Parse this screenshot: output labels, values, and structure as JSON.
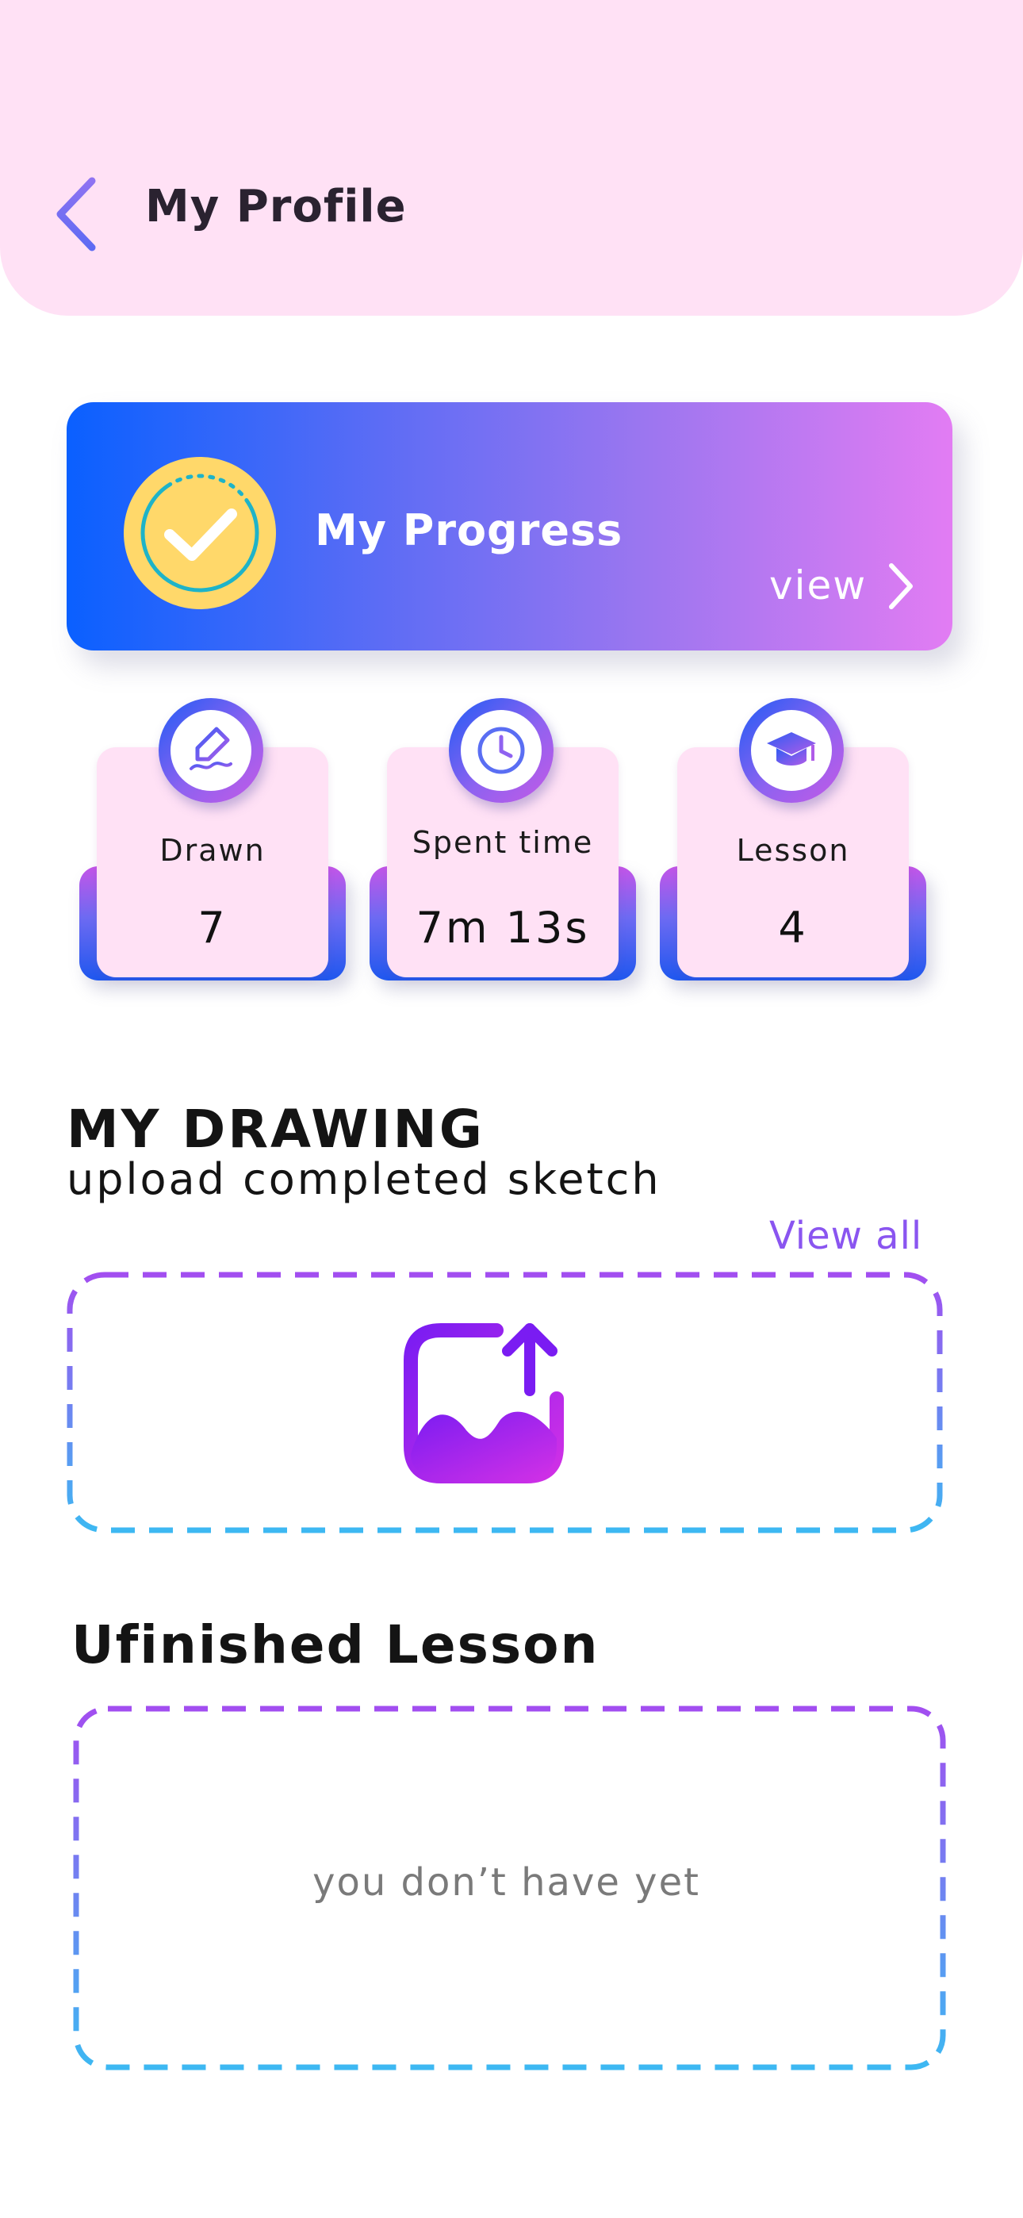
{
  "header": {
    "title": "My Profile",
    "back_icon": "chevron-left-icon"
  },
  "progress": {
    "title": "My Progress",
    "view_label": "view",
    "badge_icon": "checkmark-badge-icon",
    "chevron_icon": "chevron-right-icon"
  },
  "stats": [
    {
      "label": "Drawn",
      "value": "7",
      "icon": "pen-drawing-icon"
    },
    {
      "label": "Spent time",
      "value": "7m 13s",
      "icon": "clock-icon"
    },
    {
      "label": "Lesson",
      "value": "4",
      "icon": "graduation-cap-icon"
    }
  ],
  "my_drawing": {
    "title": "MY DRAWING",
    "subtitle": "upload completed sketch",
    "view_all": "View all",
    "upload_icon": "image-upload-icon"
  },
  "unfinished": {
    "title": "Ufinished Lesson",
    "empty_text": "you don’t have yet"
  },
  "colors": {
    "header_bg": "#ffe1f5",
    "accent_purple": "#8a55f0",
    "gradient_start": "#0a60ff",
    "gradient_end": "#e27cf3",
    "dash_top": "#a24ef0",
    "dash_bottom": "#3db8f2"
  }
}
